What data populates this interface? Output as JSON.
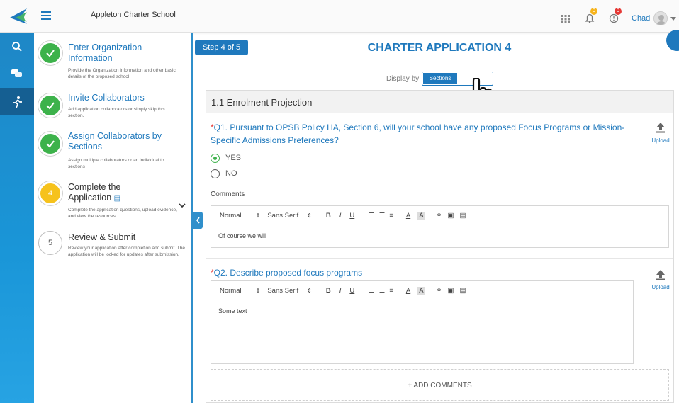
{
  "header": {
    "school_name": "Appleton Charter School",
    "user_name": "Chad",
    "notif_badge": "0",
    "alert_badge": "0"
  },
  "steps": [
    {
      "num": "✓",
      "title": "Enter Organization Information",
      "desc": "Provide the Organization information and other basic details of the proposed school"
    },
    {
      "num": "✓",
      "title": "Invite Collaborators",
      "desc": "Add application collaborators or simply skip this section."
    },
    {
      "num": "✓",
      "title": "Assign Collaborators by Sections",
      "desc": "Assign multiple collaborators or an individual to sections"
    },
    {
      "num": "4",
      "title": "Complete the Application",
      "desc": "Complete the application questions, upload evidence, and view the resources"
    },
    {
      "num": "5",
      "title": "Review & Submit",
      "desc": "Review your application after completion and submit. The application will be locked for updates after submission."
    }
  ],
  "main": {
    "step_badge": "Step 4 of 5",
    "page_title": "CHARTER APPLICATION 4",
    "display_by_label": "Display by",
    "display_by_value": "Sections",
    "section_title": "1.1 Enrolment Projection",
    "q1": {
      "star": "*",
      "text": "Q1. Pursuant to OPSB Policy HA, Section 6, will your school have any proposed Focus Programs or Mission-Specific Admissions Preferences?",
      "option_yes": "YES",
      "option_no": "NO",
      "comments_label": "Comments",
      "comment_text": "Of course we will",
      "upload_label": "Upload"
    },
    "q2": {
      "star": "*",
      "text": "Q2. Describe proposed focus programs",
      "body_text": "Some text",
      "upload_label": "Upload"
    },
    "toolbar": {
      "format": "Normal",
      "font": "Sans Serif"
    },
    "add_comments": "+ ADD COMMENTS"
  },
  "colors": {
    "accent": "#1f79bd",
    "done_green": "#3db24b",
    "current_yellow": "#f6c21c",
    "required_red": "#e53935"
  }
}
